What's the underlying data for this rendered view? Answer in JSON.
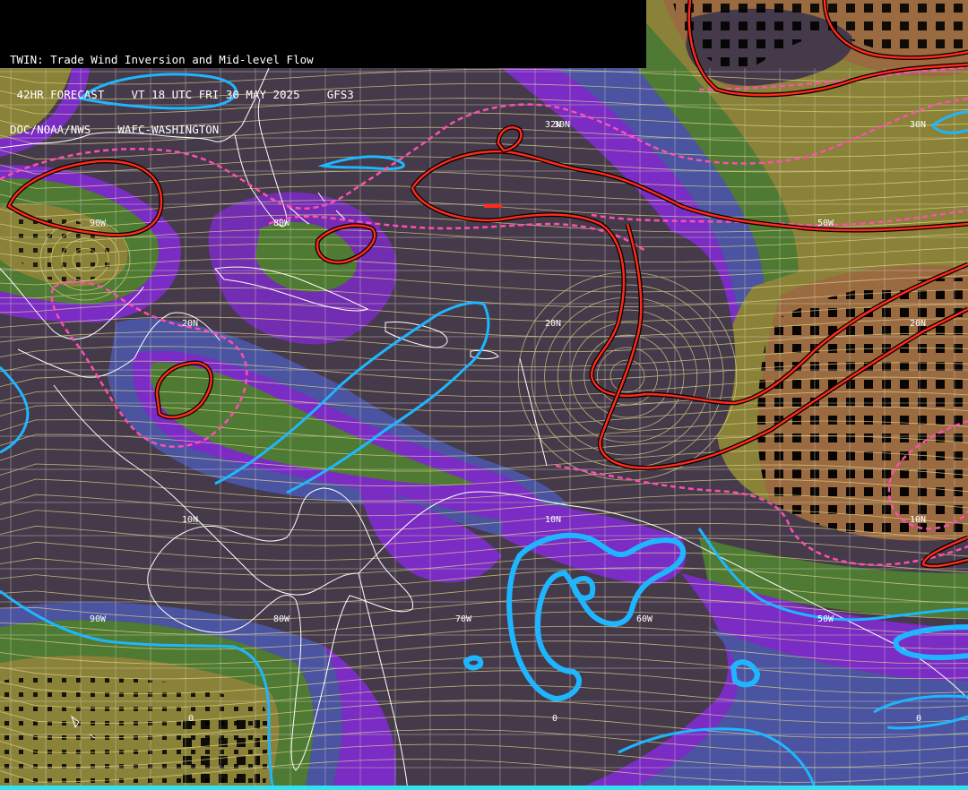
{
  "header": {
    "line1": "TWIN: Trade Wind Inversion and Mid-level Flow",
    "line2": " 42HR FORECAST    VT 18 UTC FRI 30 MAY 2025    GFS3",
    "line3": "DOC/NOAA/NWS    WAFC-WASHINGTON"
  },
  "grid_labels": {
    "lat_30_w90": "30N",
    "lat_30_w60": "32N",
    "lat_30_w40": "30N",
    "lon_90_r1": "90W",
    "lon_80_r1": "80W",
    "lon_50_r1": "50W",
    "lat_20_w80": "20N",
    "lat_20_w60": "20N",
    "lat_20_w40": "20N",
    "lat_10_w80": "10N",
    "lat_10_w60": "10N",
    "lat_10_w40": "10N",
    "lon_90_r2": "90W",
    "lon_80_r2": "80W",
    "lon_70_r2": "70W",
    "lon_60_r2": "60W",
    "lon_50_r2": "50W",
    "eq_w80": "0",
    "eq_w60": "0",
    "eq_w40": "0"
  },
  "colors": {
    "background_dark": "#453a4a",
    "purple_band": "#7a2cc4",
    "blue_band": "#4a54a0",
    "green_band": "#4e7a33",
    "olive_band": "#8a8238",
    "brown_band": "#9a6a40",
    "inversion_contour_red": "#ff2a1a",
    "dashed_contour_pink": "#ff4fb0",
    "cyan_contour": "#1fb6ff",
    "streamline": "#e6d98a",
    "coastline": "#ffffff"
  }
}
